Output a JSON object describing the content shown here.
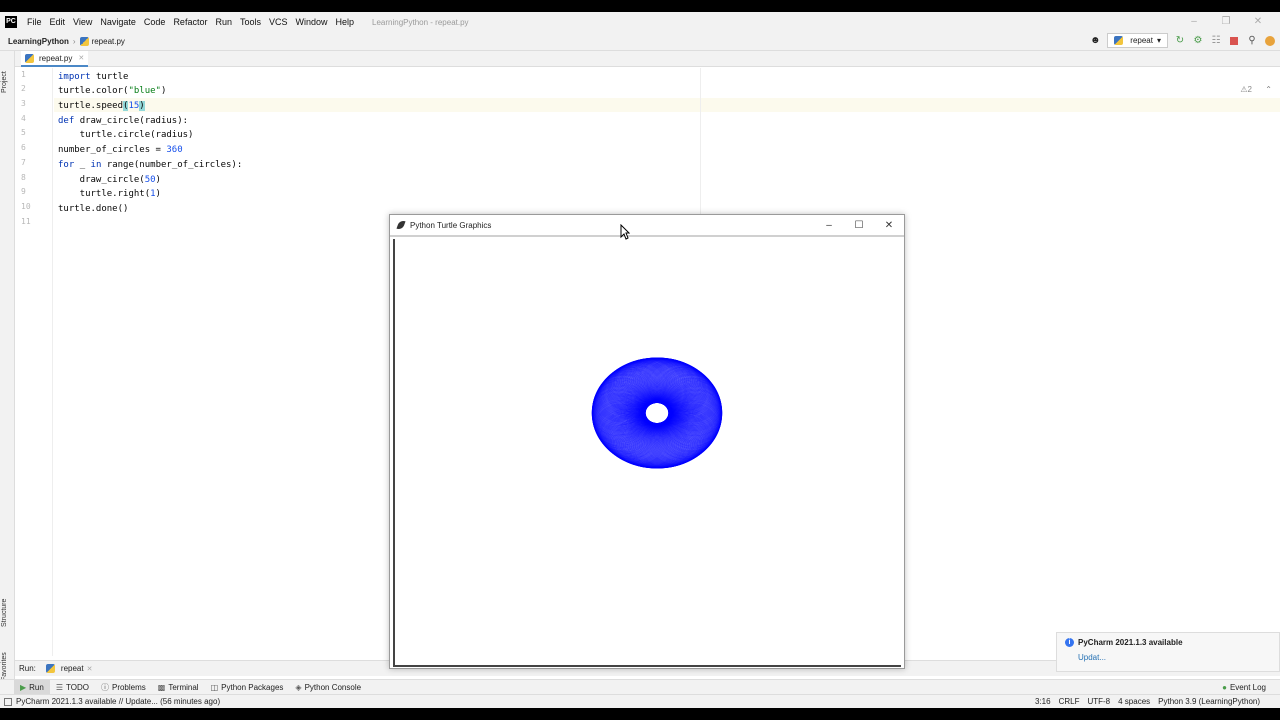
{
  "menubar": {
    "items": [
      "File",
      "Edit",
      "View",
      "Navigate",
      "Code",
      "Refactor",
      "Run",
      "Tools",
      "VCS",
      "Window",
      "Help"
    ],
    "window_title": "LearningPython - repeat.py"
  },
  "navbar": {
    "project": "LearningPython",
    "file": "repeat.py",
    "run_config": "repeat"
  },
  "left_stripe": {
    "project_label": "Project",
    "structure_label": "Structure",
    "favorites_label": "Favorites"
  },
  "editor": {
    "tab_label": "repeat.py",
    "warnings": "2",
    "line_numbers": [
      "1",
      "2",
      "3",
      "4",
      "5",
      "6",
      "7",
      "8",
      "9",
      "10",
      "11"
    ],
    "lines": [
      "import turtle",
      "turtle.color(\"blue\")",
      "turtle.speed(15)",
      "def draw_circle(radius):",
      "    turtle.circle(radius)",
      "number_of_circles = 360",
      "for _ in range(number_of_circles):",
      "    draw_circle(50)",
      "    turtle.right(1)",
      "turtle.done()",
      ""
    ]
  },
  "turtle_window": {
    "title": "Python Turtle Graphics",
    "pen_color": "#0000ff",
    "circle_count": 360
  },
  "run_panel": {
    "label": "Run:",
    "tab": "repeat"
  },
  "bottom_tools": [
    "Run",
    "TODO",
    "Problems",
    "Terminal",
    "Python Packages",
    "Python Console"
  ],
  "event_log": "Event Log",
  "notification": {
    "title": "PyCharm 2021.1.3 available",
    "link": "Updat..."
  },
  "status": {
    "message": "PyCharm 2021.1.3 available // Update... (56 minutes ago)",
    "position": "3:16",
    "line_sep": "CRLF",
    "encoding": "UTF-8",
    "indent": "4 spaces",
    "interpreter": "Python 3.9 (LearningPython)"
  }
}
